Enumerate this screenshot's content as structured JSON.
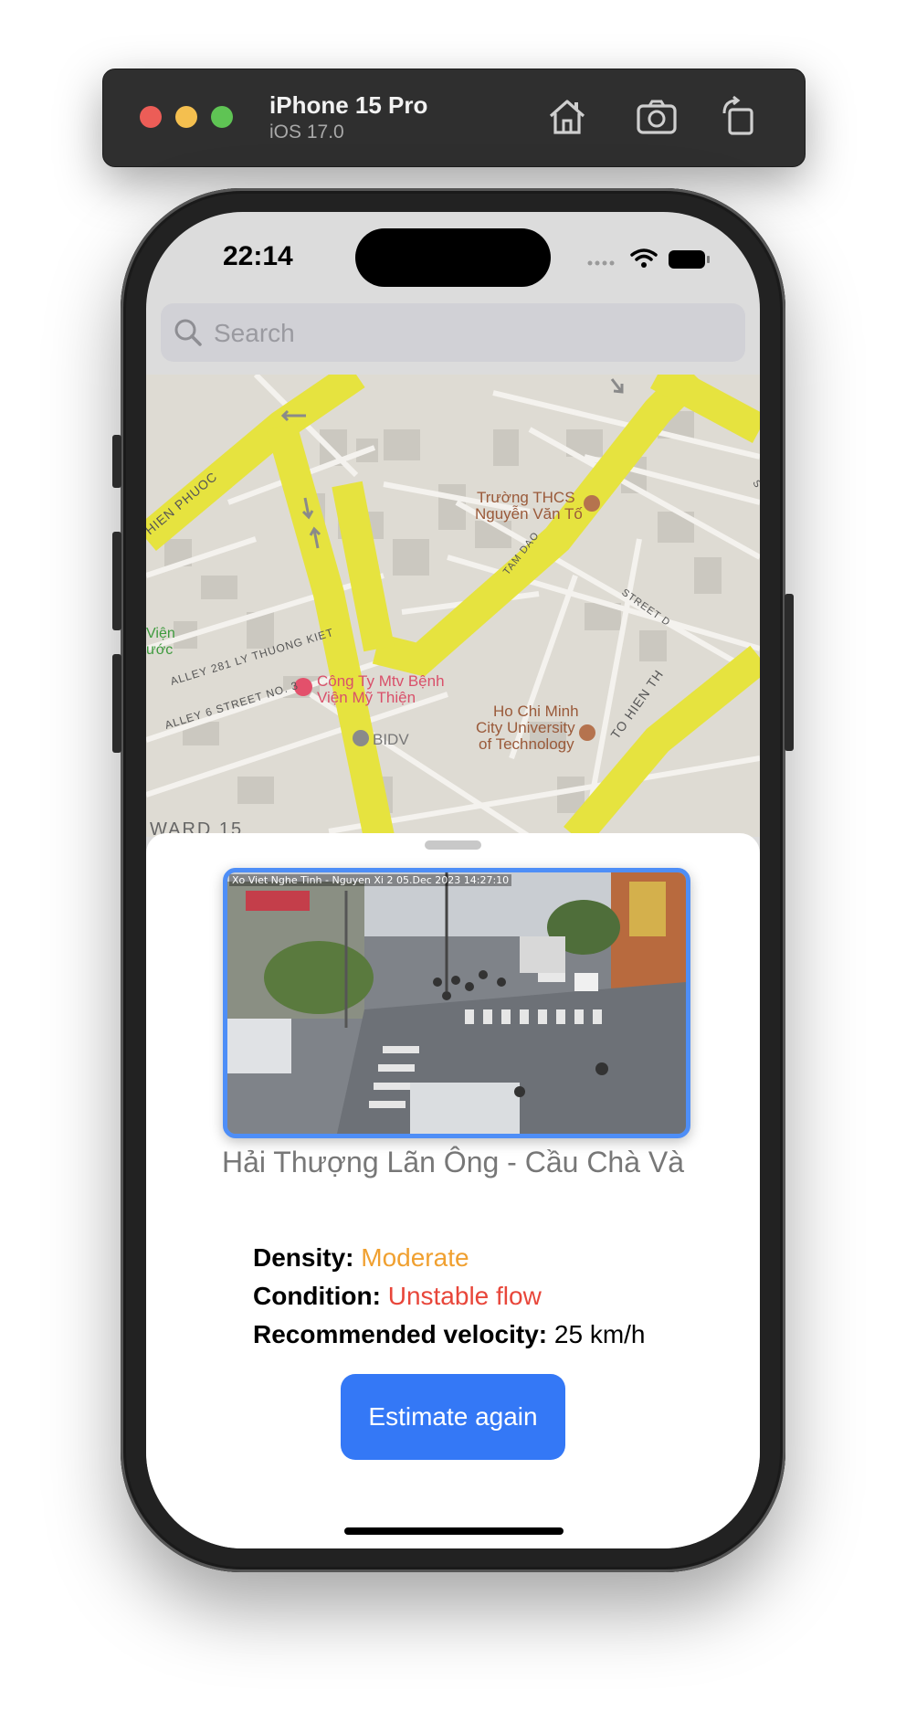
{
  "simulator": {
    "device": "iPhone 15 Pro",
    "os": "iOS 17.0",
    "buttons": [
      "home-icon",
      "screenshot-icon",
      "rotate-icon"
    ]
  },
  "status_bar": {
    "time": "22:14"
  },
  "search": {
    "placeholder": "Search"
  },
  "map": {
    "labels": {
      "school": "Trường THCS",
      "school2": "Nguyễn Văn Tố",
      "company": "Công Ty Mtv Bệnh",
      "company2": "Viện Mỹ Thiện",
      "university": "Ho Chi Minh",
      "university2": "City University",
      "university3": "of Technology",
      "bank": "BIDV",
      "alley281": "ALLEY 281 LY THUONG KIET",
      "alley6": "ALLEY 6 STREET NO. 3",
      "tamdao": "TAM DAO",
      "street": "STREET D",
      "hienphuoc": "HIEN PHUOC",
      "tohien": "TO HIEN TH",
      "vien": "Viện",
      "uoc": "ước",
      "ward": "WARD 15",
      "s": "S"
    }
  },
  "camera": {
    "overlay": "Xo Viet Nghe Tinh - Nguyen Xi 2  05.Dec 2023  14:27:10",
    "name": "Hải Thượng Lãn Ông - Cầu Chà Và"
  },
  "traffic": {
    "density_label": "Density:",
    "density_value": "Moderate",
    "condition_label": "Condition:",
    "condition_value": "Unstable flow",
    "velocity_label": "Recommended velocity:",
    "velocity_value": "25 km/h"
  },
  "colors": {
    "moderate": "#f0a030",
    "unstable": "#e8463a",
    "accent": "#3478f6"
  },
  "actions": {
    "estimate_label": "Estimate again"
  }
}
